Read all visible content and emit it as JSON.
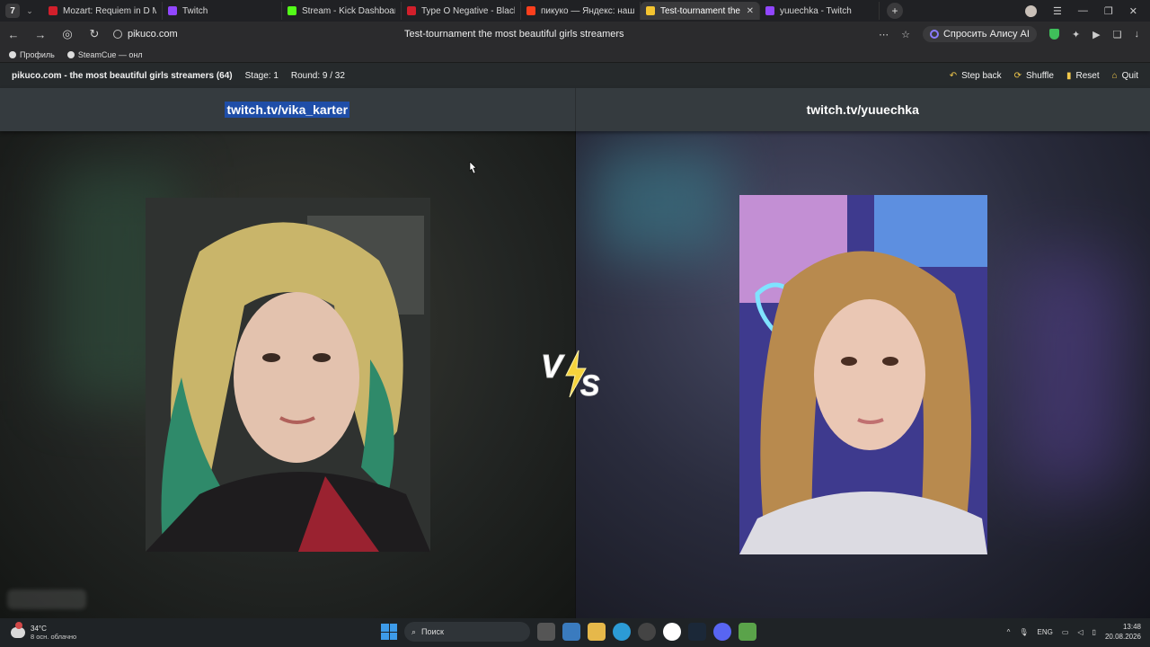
{
  "browser": {
    "logo_glyph": "7",
    "tabs": [
      {
        "title": "Mozart: Requiem in D Min",
        "color": "#d21f2b"
      },
      {
        "title": "Twitch",
        "color": "#9146ff"
      },
      {
        "title": "Stream - Kick Dashboard",
        "color": "#53fc18"
      },
      {
        "title": "Type O Negative - Black N",
        "color": "#d21f2b"
      },
      {
        "title": "пикуко — Яндекс: нашло",
        "color": "#fc3f1d"
      },
      {
        "title": "Test-tournament the m",
        "color": "#f4c430",
        "active": true
      },
      {
        "title": "yuuechka - Twitch",
        "color": "#9146ff"
      }
    ],
    "url": "pikuco.com",
    "page_title": "Test-tournament the most beautiful girls streamers",
    "alice_label": "Спросить Алису AI",
    "bookmarks": [
      {
        "label": "Профиль"
      },
      {
        "label": "SteamCue — онл"
      }
    ]
  },
  "site": {
    "name": "pikuco.com - the most beautiful girls streamers (64)",
    "stage": "Stage: 1",
    "round": "Round: 9 / 32",
    "actions": {
      "step_back": "Step back",
      "shuffle": "Shuffle",
      "reset": "Reset",
      "quit": "Quit"
    }
  },
  "match": {
    "left_name": "twitch.tv/vika_karter",
    "right_name": "twitch.tv/yuuechka"
  },
  "taskbar": {
    "temp": "34°C",
    "weather": "8 осн. облачно",
    "search_placeholder": "Поиск",
    "lang": "ENG",
    "time": "13:48",
    "date": "20.08.2026"
  }
}
